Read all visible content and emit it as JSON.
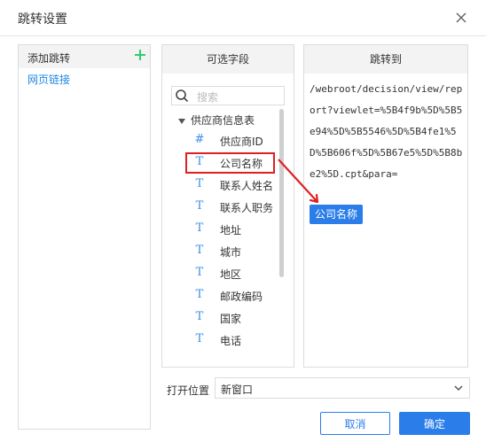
{
  "dialog": {
    "title": "跳转设置"
  },
  "left": {
    "header": "添加跳转",
    "items": [
      "网页链接"
    ]
  },
  "middle": {
    "header": "可选字段",
    "search_placeholder": "搜索",
    "root": "供应商信息表",
    "fields": [
      {
        "icon": "#",
        "label": "供应商ID"
      },
      {
        "icon": "T",
        "label": "公司名称"
      },
      {
        "icon": "T",
        "label": "联系人姓名"
      },
      {
        "icon": "T",
        "label": "联系人职务"
      },
      {
        "icon": "T",
        "label": "地址"
      },
      {
        "icon": "T",
        "label": "城市"
      },
      {
        "icon": "T",
        "label": "地区"
      },
      {
        "icon": "T",
        "label": "邮政编码"
      },
      {
        "icon": "T",
        "label": "国家"
      },
      {
        "icon": "T",
        "label": "电话"
      }
    ]
  },
  "right": {
    "header": "跳转到",
    "url": "/webroot/decision/view/report?viewlet=%5B4f9b%5D%5B5e94%5D%5B5546%5D%5B4fe1%5D%5B606f%5D%5B67e5%5D%5B8be2%5D.cpt&para=",
    "chip": "公司名称"
  },
  "footer": {
    "open_label": "打开位置",
    "open_value": "新窗口",
    "cancel": "取消",
    "ok": "确定"
  },
  "colors": {
    "accent": "#2b7de9",
    "plus": "#2ecc71",
    "highlight": "#e02020"
  }
}
